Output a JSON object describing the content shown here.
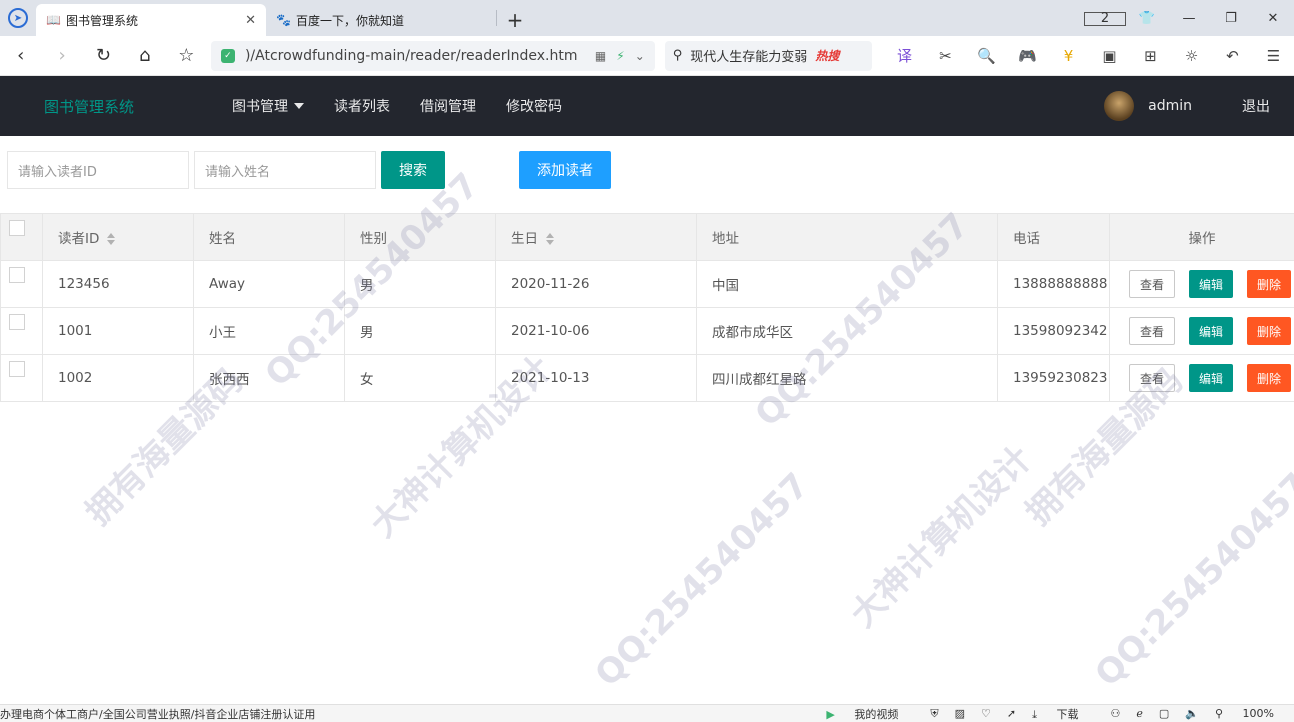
{
  "browser": {
    "tabs": [
      {
        "title": "图书管理系统",
        "active": true
      },
      {
        "title": "百度一下，你就知道",
        "active": false
      }
    ],
    "window_badge": "2",
    "url": ")/Atcrowdfunding-main/reader/readerIndex.htm",
    "search_text": "现代人生存能力变弱",
    "search_hot": "热搜"
  },
  "app": {
    "brand": "图书管理系统",
    "nav": [
      {
        "label": "图书管理",
        "dropdown": true
      },
      {
        "label": "读者列表",
        "dropdown": false
      },
      {
        "label": "借阅管理",
        "dropdown": false
      },
      {
        "label": "修改密码",
        "dropdown": false
      }
    ],
    "username": "admin",
    "logout": "退出"
  },
  "toolbar": {
    "reader_id_placeholder": "请输入读者ID",
    "name_placeholder": "请输入姓名",
    "search_label": "搜索",
    "add_label": "添加读者"
  },
  "table": {
    "headers": {
      "reader_id": "读者ID",
      "name": "姓名",
      "gender": "性别",
      "birthday": "生日",
      "address": "地址",
      "phone": "电话",
      "actions": "操作"
    },
    "rows": [
      {
        "reader_id": "123456",
        "name": "Away",
        "gender": "男",
        "birthday": "2020-11-26",
        "address": "中国",
        "phone": "13888888888"
      },
      {
        "reader_id": "1001",
        "name": "小王",
        "gender": "男",
        "birthday": "2021-10-06",
        "address": "成都市成华区",
        "phone": "13598092342"
      },
      {
        "reader_id": "1002",
        "name": "张西西",
        "gender": "女",
        "birthday": "2021-10-13",
        "address": "四川成都红星路",
        "phone": "13959230823"
      }
    ],
    "view_label": "查看",
    "edit_label": "编辑",
    "delete_label": "删除"
  },
  "statusbar": {
    "ticker": "办理电商个体工商户/全国公司营业执照/抖音企业店铺注册认证用",
    "my_video": "我的视频",
    "download": "下载",
    "zoom": "100%"
  },
  "watermarks": [
    "QQ:254540457",
    "大神计算机设计",
    "拥有海量源码"
  ],
  "colors": {
    "header_bg": "#23262e",
    "brand": "#009688",
    "search_button": "#009688",
    "add_button": "#1e9fff",
    "edit_button": "#009688",
    "delete_button": "#ff5722"
  }
}
